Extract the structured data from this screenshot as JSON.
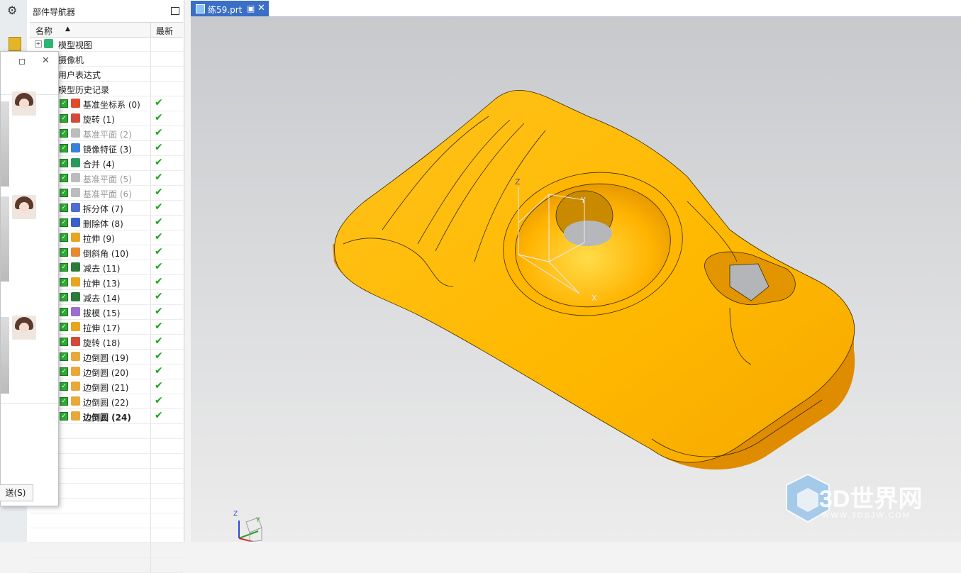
{
  "navigator": {
    "title": "部件导航器",
    "col_name": "名称",
    "col_latest": "最新",
    "nodes": [
      {
        "label": "模型视图",
        "expander": "+",
        "icon_color": "#2bb673"
      },
      {
        "label": "摄像机",
        "expander": "",
        "icon_color": "#d9412b"
      },
      {
        "label": "用户表达式",
        "expander": "",
        "icon_color": ""
      },
      {
        "label": "模型历史记录",
        "expander": "",
        "icon_color": ""
      }
    ],
    "features": [
      {
        "label": "基准坐标系 (0)",
        "icon_color": "#e04a2a",
        "dim": false,
        "bold": false
      },
      {
        "label": "旋转 (1)",
        "icon_color": "#d44a3a",
        "dim": false,
        "bold": false
      },
      {
        "label": "基准平面 (2)",
        "icon_color": "#bcbcbc",
        "dim": true,
        "bold": false
      },
      {
        "label": "镜像特征 (3)",
        "icon_color": "#3b7fd8",
        "dim": false,
        "bold": false
      },
      {
        "label": "合并 (4)",
        "icon_color": "#2a9a5a",
        "dim": false,
        "bold": false
      },
      {
        "label": "基准平面 (5)",
        "icon_color": "#bcbcbc",
        "dim": true,
        "bold": false
      },
      {
        "label": "基准平面 (6)",
        "icon_color": "#bcbcbc",
        "dim": true,
        "bold": false
      },
      {
        "label": "拆分体 (7)",
        "icon_color": "#4f6fd0",
        "dim": false,
        "bold": false
      },
      {
        "label": "删除体 (8)",
        "icon_color": "#3a5fc8",
        "dim": false,
        "bold": false
      },
      {
        "label": "拉伸 (9)",
        "icon_color": "#e7a521",
        "dim": false,
        "bold": false
      },
      {
        "label": "倒斜角 (10)",
        "icon_color": "#e58a33",
        "dim": false,
        "bold": false
      },
      {
        "label": "减去 (11)",
        "icon_color": "#2a7a3a",
        "dim": false,
        "bold": false
      },
      {
        "label": "拉伸 (13)",
        "icon_color": "#e7a521",
        "dim": false,
        "bold": false
      },
      {
        "label": "减去 (14)",
        "icon_color": "#2a7a3a",
        "dim": false,
        "bold": false
      },
      {
        "label": "拔模 (15)",
        "icon_color": "#9a6fd0",
        "dim": false,
        "bold": false
      },
      {
        "label": "拉伸 (17)",
        "icon_color": "#e7a521",
        "dim": false,
        "bold": false
      },
      {
        "label": "旋转 (18)",
        "icon_color": "#d44a3a",
        "dim": false,
        "bold": false
      },
      {
        "label": "边倒圆 (19)",
        "icon_color": "#e8a83a",
        "dim": false,
        "bold": false
      },
      {
        "label": "边倒圆 (20)",
        "icon_color": "#e8a83a",
        "dim": false,
        "bold": false
      },
      {
        "label": "边倒圆 (21)",
        "icon_color": "#e8a83a",
        "dim": false,
        "bold": false
      },
      {
        "label": "边倒圆 (22)",
        "icon_color": "#e8a83a",
        "dim": false,
        "bold": false
      },
      {
        "label": "边倒圆 (24)",
        "icon_color": "#e8a83a",
        "dim": false,
        "bold": true
      }
    ],
    "empty_rows": 10
  },
  "popup": {
    "send_label": "送(S)"
  },
  "tab": {
    "label": "练59.prt"
  },
  "viewport": {
    "axis_labels": {
      "z": "Z",
      "y": "Y",
      "x": "X"
    },
    "part_color": "#ffb400"
  },
  "watermark": {
    "name": "3D世界网",
    "url": "WWW.3DSJW.COM"
  }
}
